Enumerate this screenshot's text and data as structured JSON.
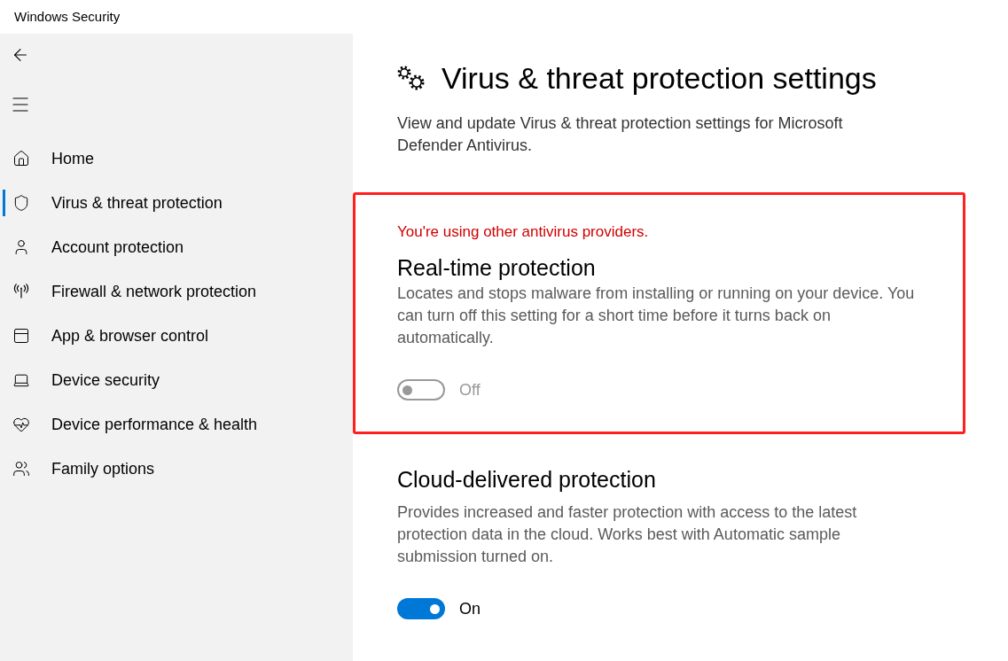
{
  "window": {
    "title": "Windows Security"
  },
  "sidebar": {
    "items": [
      {
        "label": "Home",
        "selected": false
      },
      {
        "label": "Virus & threat protection",
        "selected": true
      },
      {
        "label": "Account protection",
        "selected": false
      },
      {
        "label": "Firewall & network protection",
        "selected": false
      },
      {
        "label": "App & browser control",
        "selected": false
      },
      {
        "label": "Device security",
        "selected": false
      },
      {
        "label": "Device performance & health",
        "selected": false
      },
      {
        "label": "Family options",
        "selected": false
      }
    ]
  },
  "page": {
    "title": "Virus & threat protection settings",
    "description": "View and update Virus & threat protection settings for Microsoft Defender Antivirus."
  },
  "settings": [
    {
      "highlighted": true,
      "warning": "You're using other antivirus providers.",
      "title": "Real-time protection",
      "description": "Locates and stops malware from installing or running on your device. You can turn off this setting for a short time before it turns back on automatically.",
      "toggle": {
        "on": false,
        "disabled": true,
        "label": "Off"
      }
    },
    {
      "highlighted": false,
      "title": "Cloud-delivered protection",
      "description": "Provides increased and faster protection with access to the latest protection data in the cloud. Works best with Automatic sample submission turned on.",
      "toggle": {
        "on": true,
        "disabled": false,
        "label": "On"
      }
    }
  ]
}
